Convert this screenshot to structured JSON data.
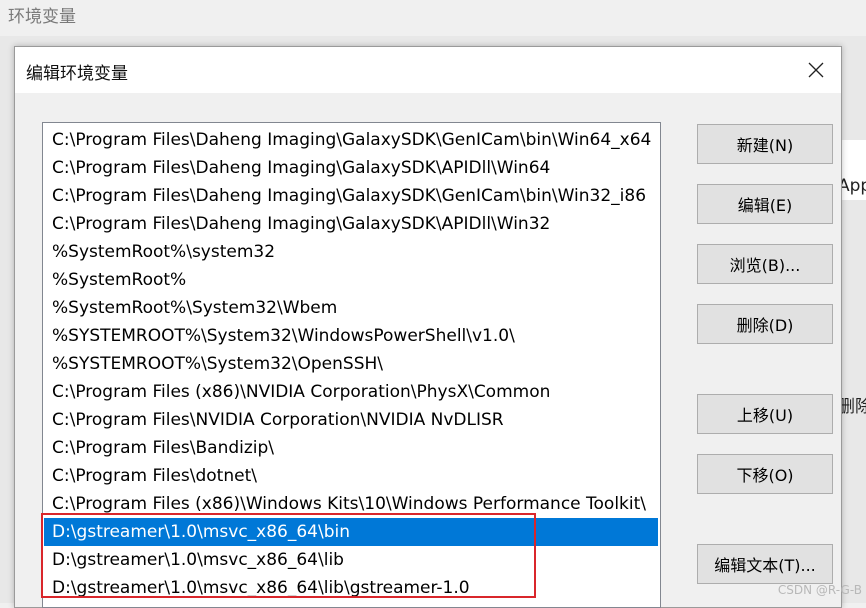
{
  "background_window": {
    "title": "环境变量",
    "right_edge_texts": [
      "App",
      "删除("
    ]
  },
  "dialog": {
    "title": "编辑环境变量",
    "close_icon": "close-icon"
  },
  "paths": [
    "C:\\Program Files\\Daheng Imaging\\GalaxySDK\\GenICam\\bin\\Win64_x64",
    "C:\\Program Files\\Daheng Imaging\\GalaxySDK\\APIDll\\Win64",
    "C:\\Program Files\\Daheng Imaging\\GalaxySDK\\GenICam\\bin\\Win32_i86",
    "C:\\Program Files\\Daheng Imaging\\GalaxySDK\\APIDll\\Win32",
    "%SystemRoot%\\system32",
    "%SystemRoot%",
    "%SystemRoot%\\System32\\Wbem",
    "%SYSTEMROOT%\\System32\\WindowsPowerShell\\v1.0\\",
    "%SYSTEMROOT%\\System32\\OpenSSH\\",
    "C:\\Program Files (x86)\\NVIDIA Corporation\\PhysX\\Common",
    "C:\\Program Files\\NVIDIA Corporation\\NVIDIA NvDLISR",
    "C:\\Program Files\\Bandizip\\",
    "C:\\Program Files\\dotnet\\",
    "C:\\Program Files (x86)\\Windows Kits\\10\\Windows Performance Toolkit\\",
    "D:\\gstreamer\\1.0\\msvc_x86_64\\bin",
    "D:\\gstreamer\\1.0\\msvc_x86_64\\lib",
    "D:\\gstreamer\\1.0\\msvc_x86_64\\lib\\gstreamer-1.0"
  ],
  "selected_index": 14,
  "buttons": {
    "new": "新建(N)",
    "edit": "编辑(E)",
    "browse": "浏览(B)...",
    "delete": "删除(D)",
    "move_up": "上移(U)",
    "move_down": "下移(O)",
    "edit_text": "编辑文本(T)..."
  },
  "colors": {
    "selection": "#0078d7",
    "annotation_box": "#d9262b"
  },
  "watermark": "CSDN @R-G-B"
}
